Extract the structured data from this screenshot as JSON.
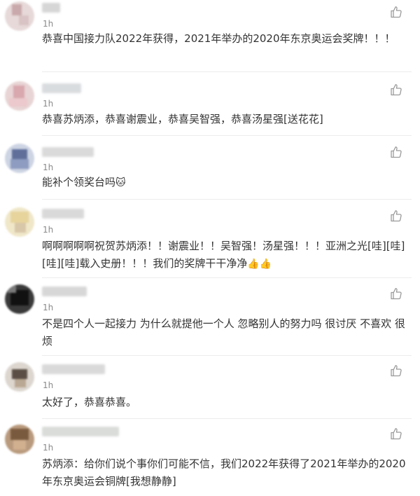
{
  "comments": [
    {
      "time": "1h",
      "text": "恭喜中国接力队2022年获得，2021年举办的2020年东京奥运会奖牌！！！"
    },
    {
      "time": "1h",
      "text": "恭喜苏炳添，恭喜谢震业，恭喜吴智强，恭喜汤星强[送花花]"
    },
    {
      "time": "1h",
      "text": "能补个领奖台吗",
      "emoji": "🐱"
    },
    {
      "time": "1h",
      "text": "啊啊啊啊啊祝贺苏炳添！！谢震业！！吴智强！汤星强！！！亚洲之光[哇][哇][哇][哇]载入史册！！！我们的奖牌干干净净",
      "emoji": "👍👍"
    },
    {
      "time": "1h",
      "text": "不是四个人一起接力 为什么就提他一个人 忽略别人的努力吗 很讨厌 不喜欢 很烦"
    },
    {
      "time": "1h",
      "text": "太好了，恭喜恭喜。"
    },
    {
      "time": "1h",
      "text": "苏炳添：给你们说个事你们可能不信，我们2022年获得了2021年举办的2020年东京奥运会铜牌[我想静静]"
    }
  ],
  "icons": {
    "like": "thumbs-up-icon"
  },
  "colors": {
    "text": "#333333",
    "time": "#8a8a8a",
    "icon": "#9a9a9a",
    "divider": "#ececec"
  }
}
